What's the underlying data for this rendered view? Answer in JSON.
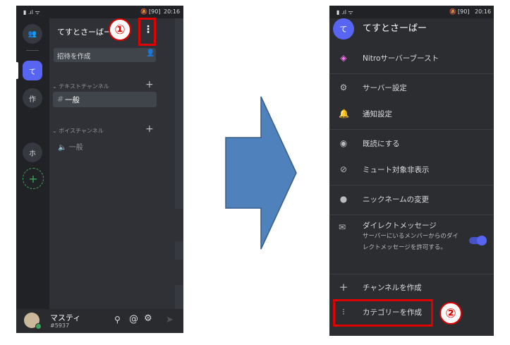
{
  "status_bar": {
    "time": "20:16",
    "battery": "90"
  },
  "left": {
    "server_name": "てすとさーばー",
    "invite_button": "招待を作成",
    "categories": [
      {
        "label": "テキストチャンネル",
        "channels": [
          "一般"
        ]
      },
      {
        "label": "ボイスチャンネル",
        "channels": [
          "一般"
        ]
      }
    ],
    "channel_prefix_text": "#",
    "rail": [
      "て",
      "作",
      "ホ"
    ],
    "user": {
      "name": "マスティ",
      "tag": "#5937"
    },
    "step_marker": "①"
  },
  "right": {
    "server_name": "てすとさーばー",
    "server_avatar": "て",
    "menu": [
      {
        "label": "Nitroサーバーブースト",
        "icon": "boost-icon"
      },
      {
        "label": "サーバー設定",
        "icon": "gear-icon"
      },
      {
        "label": "通知設定",
        "icon": "bell-icon"
      },
      {
        "label": "既読にする",
        "icon": "eye-icon"
      },
      {
        "label": "ミュート対象非表示",
        "icon": "eye-off-icon"
      },
      {
        "label": "ニックネームの変更",
        "icon": "person-icon"
      },
      {
        "label": "ダイレクトメッセージ",
        "icon": "dm-icon",
        "desc": "サーバーにいるメンバーからのダイレクトメッセージを許可する。",
        "toggle": true
      },
      {
        "label": "チャンネルを作成",
        "icon": "plus-icon"
      },
      {
        "label": "カテゴリーを作成",
        "icon": "category-icon"
      }
    ],
    "step_marker": "②"
  },
  "colors": {
    "accent": "#5865f2",
    "highlight": "#e00000",
    "arrow": "#4f81bd"
  }
}
